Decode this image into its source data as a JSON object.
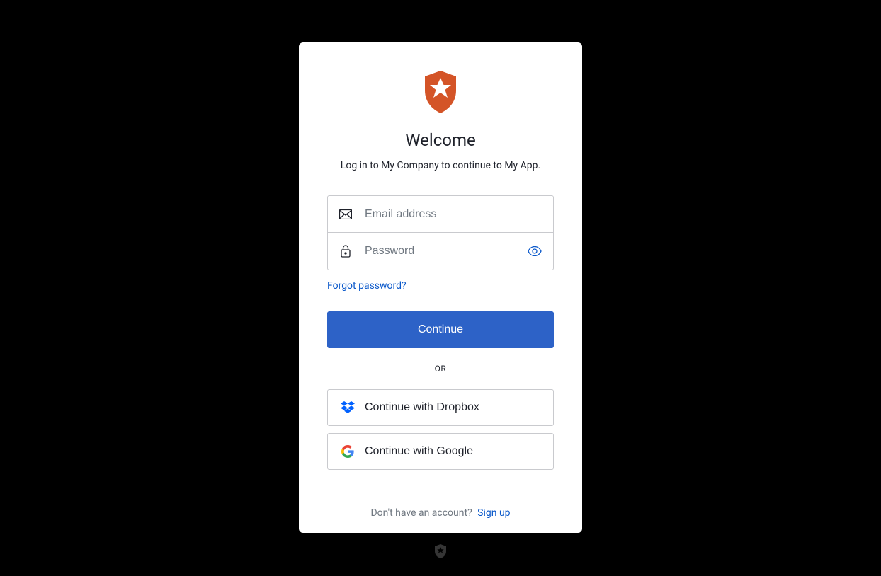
{
  "header": {
    "title": "Welcome",
    "subtitle": "Log in to My Company to continue to My App."
  },
  "form": {
    "email_placeholder": "Email address",
    "password_placeholder": "Password",
    "forgot_label": "Forgot password?",
    "continue_label": "Continue"
  },
  "divider": {
    "label": "OR"
  },
  "social": {
    "dropbox_label": "Continue with Dropbox",
    "google_label": "Continue with Google"
  },
  "footer": {
    "prompt": "Don't have an account?",
    "signup_label": "Sign up"
  },
  "colors": {
    "brand": "#d45427",
    "primary": "#2d62c7",
    "link": "#0a58ca"
  }
}
